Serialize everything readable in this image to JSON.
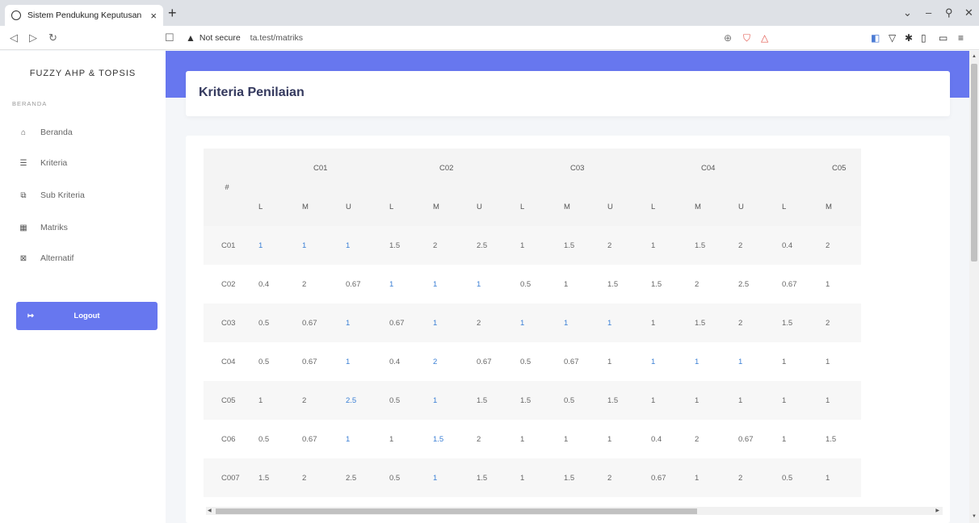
{
  "browser": {
    "tab_title": "Sistem Pendukung Keputusan",
    "tab_close": "×",
    "new_tab": "+",
    "not_secure": "Not secure",
    "url": "ta.test/matriks"
  },
  "sidebar": {
    "brand": "FUZZY AHP & TOPSIS",
    "section": "BERANDA",
    "items": [
      {
        "label": "Beranda",
        "icon": "home-icon"
      },
      {
        "label": "Kriteria",
        "icon": "list-icon"
      },
      {
        "label": "Sub Kriteria",
        "icon": "copy-icon"
      },
      {
        "label": "Matriks",
        "icon": "table-icon"
      },
      {
        "label": "Alternatif",
        "icon": "clipboard-icon"
      }
    ],
    "logout": "Logout"
  },
  "page": {
    "title": "Kriteria Penilaian"
  },
  "colors": {
    "accent": "#6777ef",
    "value_highlight": "#3a7fd5"
  },
  "matrix": {
    "hash": "#",
    "criteria": [
      "C01",
      "C02",
      "C03",
      "C04",
      "C05"
    ],
    "sub": [
      "L",
      "M",
      "U"
    ],
    "rows": [
      {
        "label": "C01",
        "values": [
          "1",
          "1",
          "1",
          "1.5",
          "2",
          "2.5",
          "1",
          "1.5",
          "2",
          "1",
          "1.5",
          "2",
          "0.4",
          "2"
        ]
      },
      {
        "label": "C02",
        "values": [
          "0.4",
          "2",
          "0.67",
          "1",
          "1",
          "1",
          "0.5",
          "1",
          "1.5",
          "1.5",
          "2",
          "2.5",
          "0.67",
          "1"
        ]
      },
      {
        "label": "C03",
        "values": [
          "0.5",
          "0.67",
          "1",
          "0.67",
          "1",
          "2",
          "1",
          "1",
          "1",
          "1",
          "1.5",
          "2",
          "1.5",
          "2"
        ]
      },
      {
        "label": "C04",
        "values": [
          "0.5",
          "0.67",
          "1",
          "0.4",
          "2",
          "0.67",
          "0.5",
          "0.67",
          "1",
          "1",
          "1",
          "1",
          "1",
          "1"
        ]
      },
      {
        "label": "C05",
        "values": [
          "1",
          "2",
          "2.5",
          "0.5",
          "1",
          "1.5",
          "1.5",
          "0.5",
          "1.5",
          "1",
          "1",
          "1",
          "1",
          "1"
        ]
      },
      {
        "label": "C06",
        "values": [
          "0.5",
          "0.67",
          "1",
          "1",
          "1.5",
          "2",
          "1",
          "1",
          "1",
          "0.4",
          "2",
          "0.67",
          "1",
          "1.5"
        ]
      },
      {
        "label": "C007",
        "values": [
          "1.5",
          "2",
          "2.5",
          "0.5",
          "1",
          "1.5",
          "1",
          "1.5",
          "2",
          "0.67",
          "1",
          "2",
          "0.5",
          "1"
        ]
      }
    ]
  }
}
